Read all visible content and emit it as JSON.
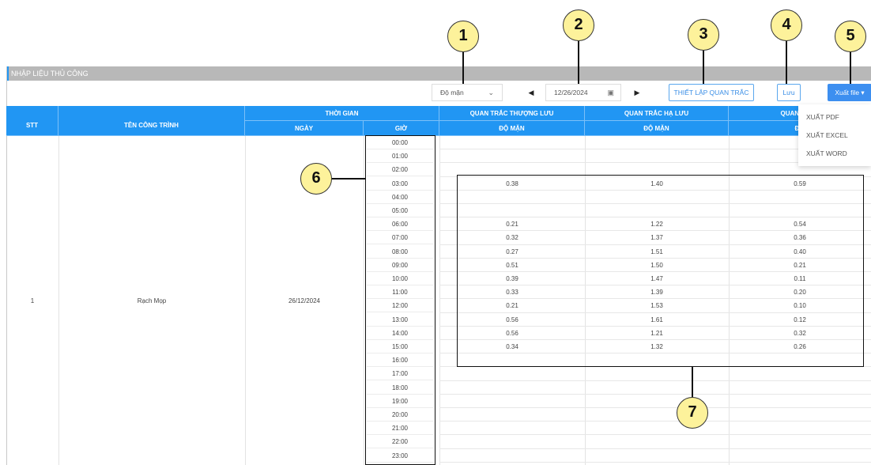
{
  "panel": {
    "title": "NHẬP LIỆU THỦ CÔNG"
  },
  "toolbar": {
    "select_value": "Độ mặn",
    "chevron_icon": "chevron-down-icon",
    "prev_icon": "◀",
    "next_icon": "▶",
    "date_value": "12/26/2024",
    "calendar_icon": "calendar-icon",
    "setup_label": "THIẾT LẬP QUAN TRẮC",
    "save_label": "Lưu",
    "export_label": "Xuất file ▾"
  },
  "export_menu": [
    "XUẤT PDF",
    "XUẤT EXCEL",
    "XUẤT WORD"
  ],
  "table": {
    "headers": {
      "stt": "STT",
      "name": "TÊN CÔNG TRÌNH",
      "time_group": "THỜI GIAN",
      "date": "NGÀY",
      "hour": "GIỜ",
      "upstream": "QUAN TRẮC THƯỢNG LƯU",
      "downstream": "QUAN TRẮC HẠ LƯU",
      "third": "QUAN TRẮC",
      "salinity1": "ĐỘ MẶN",
      "salinity2": "ĐỘ MẶN",
      "salinity3": "ĐỘ"
    },
    "row": {
      "stt": "1",
      "name": "Rạch Mọp",
      "date": "26/12/2024"
    },
    "hours": [
      "00:00",
      "01:00",
      "02:00",
      "03:00",
      "04:00",
      "05:00",
      "06:00",
      "07:00",
      "08:00",
      "09:00",
      "10:00",
      "11:00",
      "12:00",
      "13:00",
      "14:00",
      "15:00",
      "16:00",
      "17:00",
      "18:00",
      "19:00",
      "20:00",
      "21:00",
      "22:00",
      "23:00"
    ],
    "values": [
      [
        "",
        "",
        ""
      ],
      [
        "",
        "",
        ""
      ],
      [
        "",
        "",
        ""
      ],
      [
        "0.38",
        "1.40",
        "0.59"
      ],
      [
        "",
        "",
        ""
      ],
      [
        "",
        "",
        ""
      ],
      [
        "0.21",
        "1.22",
        "0.54"
      ],
      [
        "0.32",
        "1.37",
        "0.36"
      ],
      [
        "0.27",
        "1.51",
        "0.40"
      ],
      [
        "0.51",
        "1.50",
        "0.21"
      ],
      [
        "0.39",
        "1.47",
        "0.11"
      ],
      [
        "0.33",
        "1.39",
        "0.20"
      ],
      [
        "0.21",
        "1.53",
        "0.10"
      ],
      [
        "0.56",
        "1.61",
        "0.12"
      ],
      [
        "0.56",
        "1.21",
        "0.32"
      ],
      [
        "0.34",
        "1.32",
        "0.26"
      ],
      [
        "",
        "",
        ""
      ],
      [
        "",
        "",
        ""
      ],
      [
        "",
        "",
        ""
      ],
      [
        "",
        "",
        ""
      ],
      [
        "",
        "",
        ""
      ],
      [
        "",
        "",
        ""
      ],
      [
        "",
        "",
        ""
      ],
      [
        "",
        "",
        ""
      ]
    ]
  },
  "annotations": [
    "1",
    "2",
    "3",
    "4",
    "5",
    "6",
    "7"
  ]
}
